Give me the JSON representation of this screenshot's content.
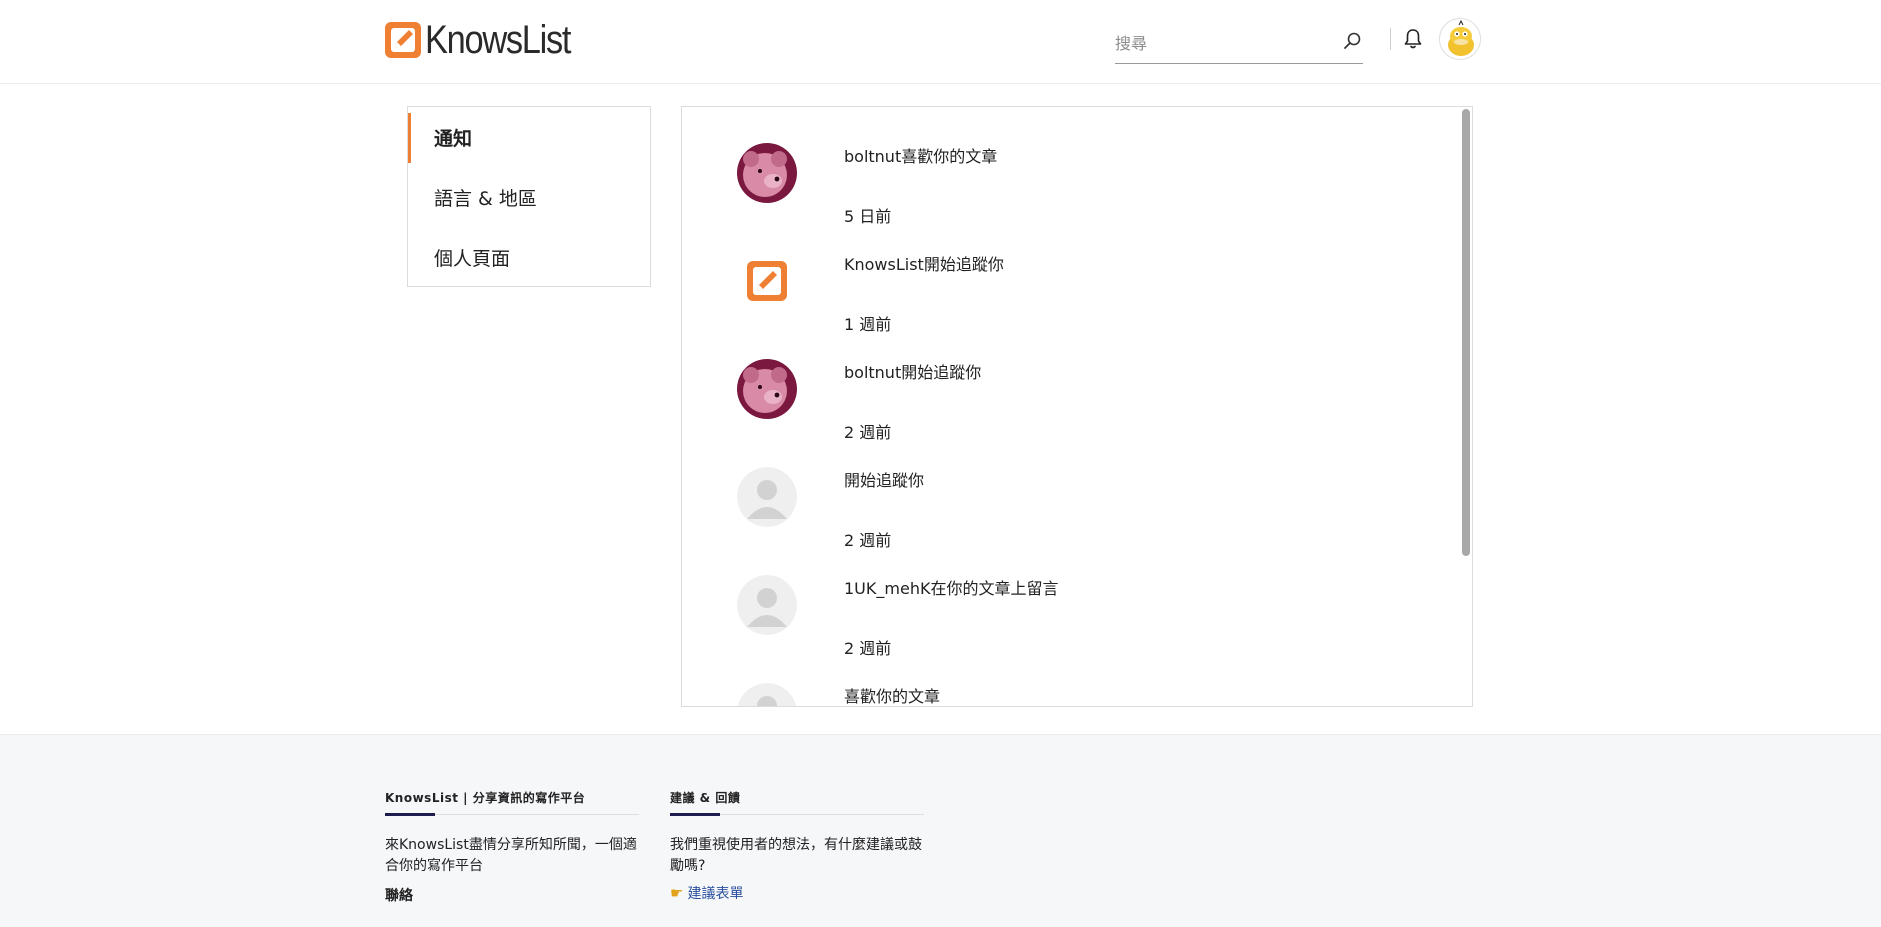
{
  "header": {
    "brand": "KnowsList",
    "search_placeholder": "搜尋"
  },
  "sidebar": {
    "items": [
      {
        "label": "通知"
      },
      {
        "label": "語言 & 地區"
      },
      {
        "label": "個人頁面"
      }
    ]
  },
  "notifications": [
    {
      "text": "boltnut喜歡你的文章",
      "time": "5 日前",
      "avatar": "pink-bear"
    },
    {
      "text": "KnowsList開始追蹤你",
      "time": "1 週前",
      "avatar": "knowslist-logo"
    },
    {
      "text": "boltnut開始追蹤你",
      "time": "2 週前",
      "avatar": "pink-bear"
    },
    {
      "text": "開始追蹤你",
      "time": "2 週前",
      "avatar": "default-user"
    },
    {
      "text": "1UK_mehK在你的文章上留言",
      "time": "2 週前",
      "avatar": "default-user"
    },
    {
      "text": "喜歡你的文章",
      "time": "",
      "avatar": "default-user"
    }
  ],
  "footer": {
    "col1": {
      "title": "KnowsList | 分享資訊的寫作平台",
      "desc": "來KnowsList盡情分享所知所聞，一個適合你的寫作平台",
      "sub": "聯絡"
    },
    "col2": {
      "title": "建議 & 回饋",
      "desc": "我們重視使用者的想法，有什麼建議或鼓勵嗎?",
      "link": "建議表單"
    }
  },
  "colors": {
    "accent": "#ee7f33",
    "footer_bg": "#f6f7f9",
    "link": "#2a4fa0"
  }
}
